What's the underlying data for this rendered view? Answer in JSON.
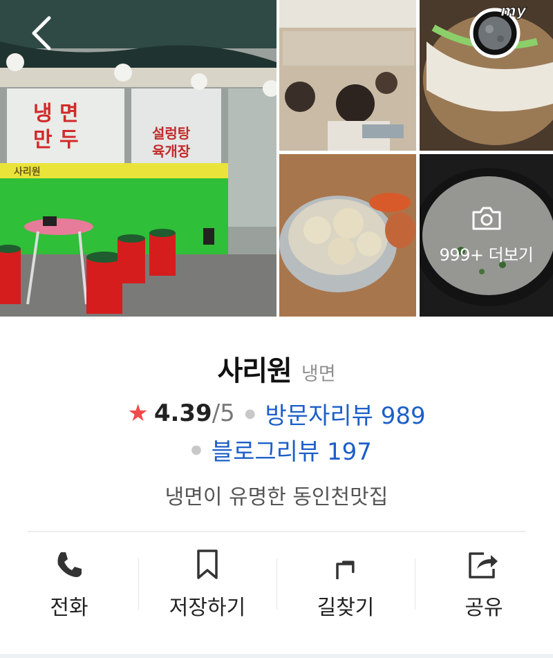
{
  "gallery": {
    "more_photos_label": "999+ 더보기",
    "my_badge_text": "my",
    "storefront_sign": {
      "window_left": [
        "냉 면",
        "만 두"
      ],
      "window_right": [
        "설렁탕",
        "육개장"
      ],
      "banner": "사리원"
    }
  },
  "place": {
    "name": "사리원",
    "category": "냉면",
    "rating": "4.39",
    "rating_max": "/5",
    "visitor_reviews": "방문자리뷰 989",
    "blog_reviews": "블로그리뷰 197",
    "description": "냉면이 유명한 동인천맛집"
  },
  "actions": {
    "call": "전화",
    "save": "저장하기",
    "directions": "길찾기",
    "share": "공유"
  },
  "colors": {
    "star": "#f04a4a",
    "link": "#1d5fc9"
  }
}
